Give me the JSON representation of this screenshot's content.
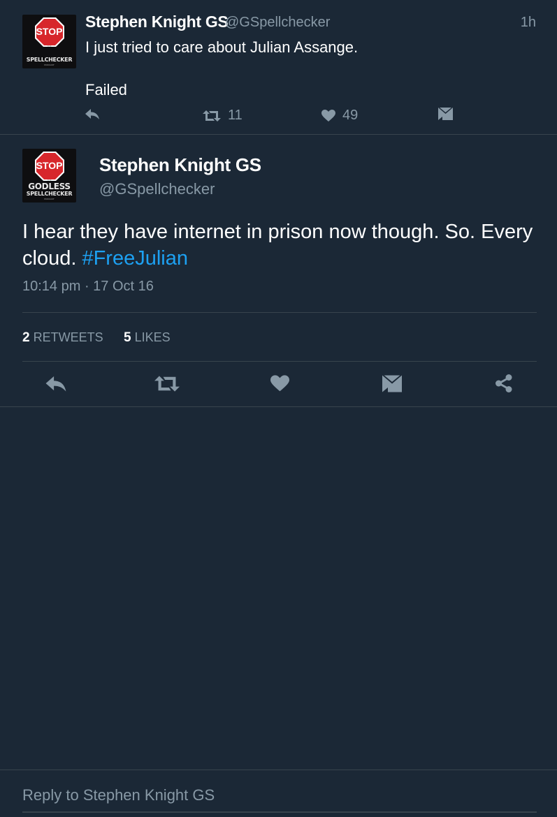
{
  "colors": {
    "background": "#1b2836",
    "divider": "#38444d",
    "muted": "#8899a6",
    "link": "#1da1f2",
    "icon": "#8899a6",
    "stop_red": "#d7262b"
  },
  "avatar": {
    "sign_text": "STOP",
    "brand_line1": "GODLESS",
    "brand_line2": "SPELLCHECKER",
    "small_top": "THE",
    "small_bottom": "PODCAST"
  },
  "parent_tweet": {
    "name": "Stephen Knight GS",
    "handle": "@GSpellchecker",
    "time": "1h",
    "text_line1": "I just tried to care about Julian Assange.",
    "text_line2": "Failed",
    "actions": {
      "reply_icon": "reply-icon",
      "retweet_icon": "retweet-icon",
      "retweet_count": "11",
      "like_icon": "heart-icon",
      "like_count": "49",
      "dm_icon": "direct-message-icon"
    }
  },
  "detail_tweet": {
    "name": "Stephen Knight GS",
    "handle": "@GSpellchecker",
    "text_before": "I hear they have internet in prison now though. So. Every cloud. ",
    "hashtag": "#FreeJulian",
    "timestamp": "10:14 pm · 17 Oct 16",
    "retweets_count": "2",
    "retweets_label": "RETWEETS",
    "likes_count": "5",
    "likes_label": "LIKES",
    "actions": [
      "reply-icon",
      "retweet-icon",
      "heart-icon",
      "direct-message-icon",
      "share-icon"
    ]
  },
  "reply": {
    "placeholder": "Reply to Stephen Knight GS"
  }
}
